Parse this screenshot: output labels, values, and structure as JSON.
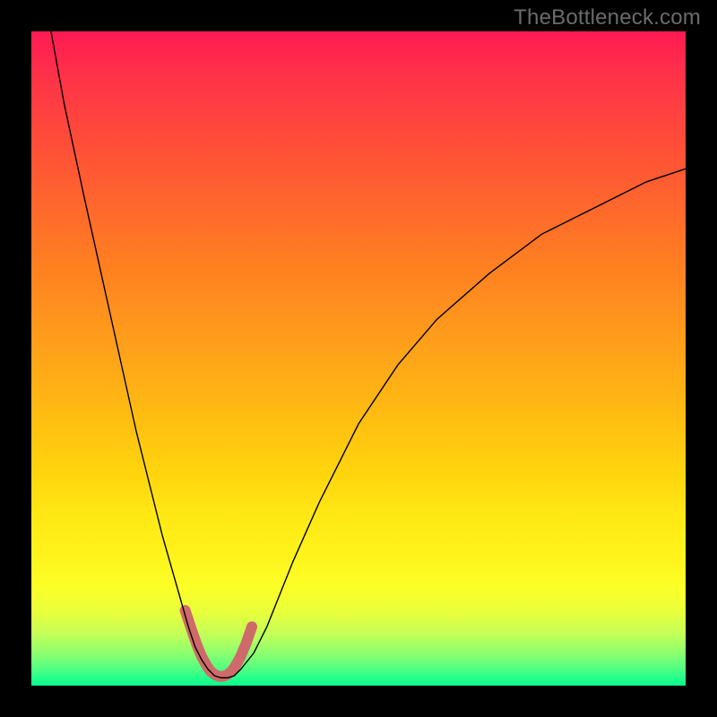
{
  "watermark": "TheBottleneck.com",
  "chart_data": {
    "type": "line",
    "title": "",
    "xlabel": "",
    "ylabel": "",
    "xlim": [
      0,
      100
    ],
    "ylim": [
      0,
      100
    ],
    "grid": false,
    "legend": false,
    "background": "rainbow-gradient-vertical",
    "series": [
      {
        "name": "bottleneck-curve",
        "x": [
          3,
          5,
          8,
          10,
          12,
          14,
          16,
          18,
          20,
          22,
          24,
          25,
          26,
          27,
          28,
          29,
          30,
          31,
          32,
          34,
          36,
          38,
          40,
          44,
          50,
          56,
          62,
          70,
          78,
          86,
          94,
          100
        ],
        "values": [
          100,
          89,
          75,
          66,
          57,
          48,
          39,
          31,
          23,
          16,
          9,
          6,
          4,
          2.5,
          1.5,
          1.2,
          1.2,
          1.5,
          2.5,
          5,
          9,
          14,
          19,
          28,
          40,
          49,
          56,
          63,
          69,
          73,
          77,
          79
        ],
        "stroke": "#000000",
        "stroke_width": 1.4
      },
      {
        "name": "valley-highlight",
        "x": [
          23.5,
          24.5,
          25.3,
          26.0,
          26.7,
          27.3,
          28.0,
          28.7,
          29.3,
          30.0,
          30.7,
          31.3,
          32.0,
          32.8,
          33.7
        ],
        "values": [
          11.5,
          8.5,
          6.2,
          4.5,
          3.2,
          2.3,
          1.7,
          1.4,
          1.4,
          1.7,
          2.3,
          3.2,
          4.5,
          6.4,
          9.0
        ],
        "stroke": "#cf6a6a",
        "stroke_width": 12,
        "linecap": "round"
      }
    ],
    "annotations": []
  }
}
